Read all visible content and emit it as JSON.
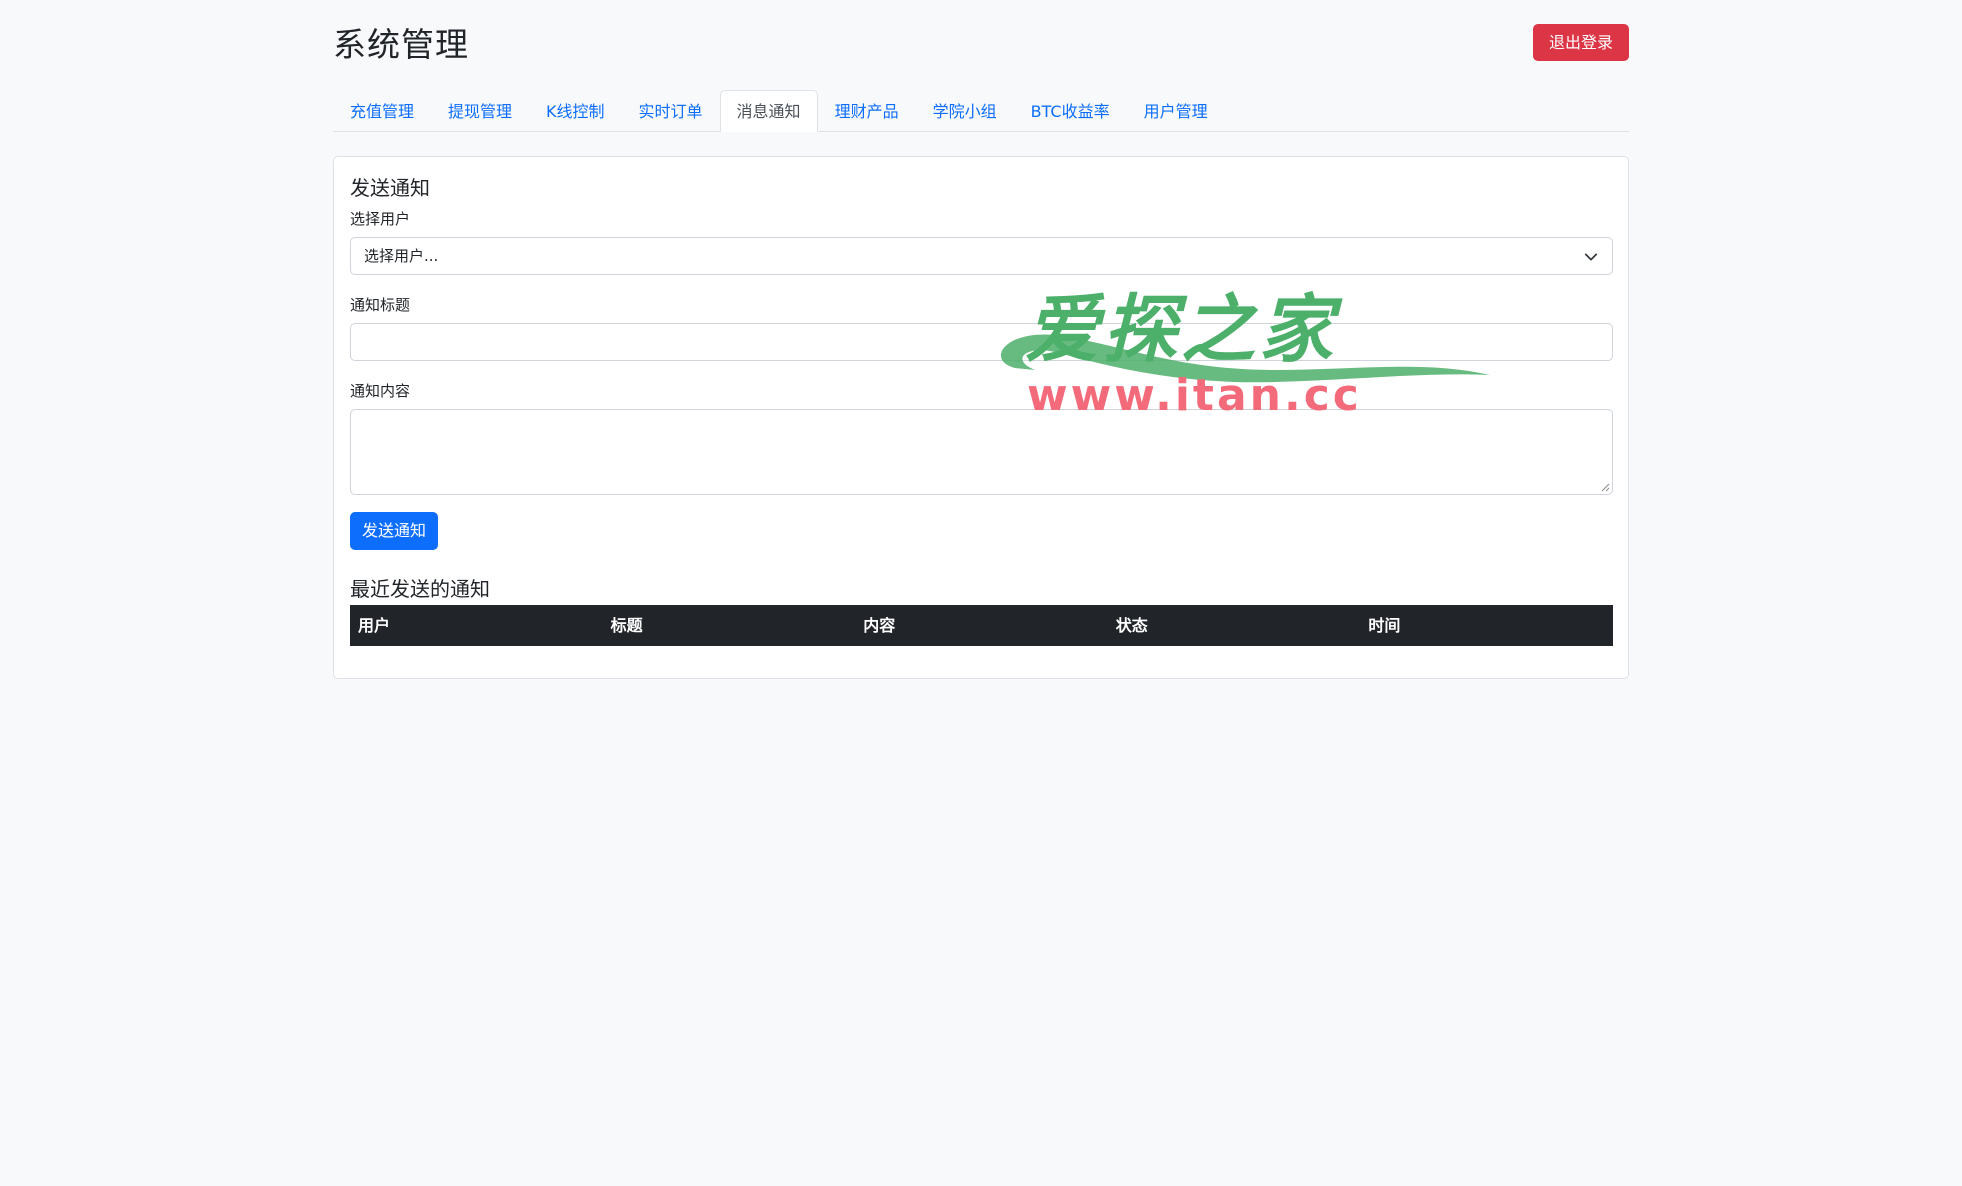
{
  "header": {
    "title": "系统管理",
    "logout_label": "退出登录"
  },
  "tabs": [
    {
      "label": "充值管理",
      "active": false
    },
    {
      "label": "提现管理",
      "active": false
    },
    {
      "label": "K线控制",
      "active": false
    },
    {
      "label": "实时订单",
      "active": false
    },
    {
      "label": "消息通知",
      "active": true
    },
    {
      "label": "理财产品",
      "active": false
    },
    {
      "label": "学院小组",
      "active": false
    },
    {
      "label": "BTC收益率",
      "active": false
    },
    {
      "label": "用户管理",
      "active": false
    }
  ],
  "form": {
    "card_title": "发送通知",
    "user_label": "选择用户",
    "user_select_value": "选择用户...",
    "title_label": "通知标题",
    "title_value": "",
    "content_label": "通知内容",
    "content_value": "",
    "send_label": "发送通知"
  },
  "recent": {
    "title": "最近发送的通知",
    "columns": [
      "用户",
      "标题",
      "内容",
      "状态",
      "时间"
    ],
    "rows": []
  },
  "watermark": {
    "text_cn": "爱探之家",
    "url": "www.itan.cc"
  },
  "colors": {
    "primary": "#0d6efd",
    "danger": "#dc3545",
    "dark": "#212529",
    "background": "#f8f9fa"
  }
}
